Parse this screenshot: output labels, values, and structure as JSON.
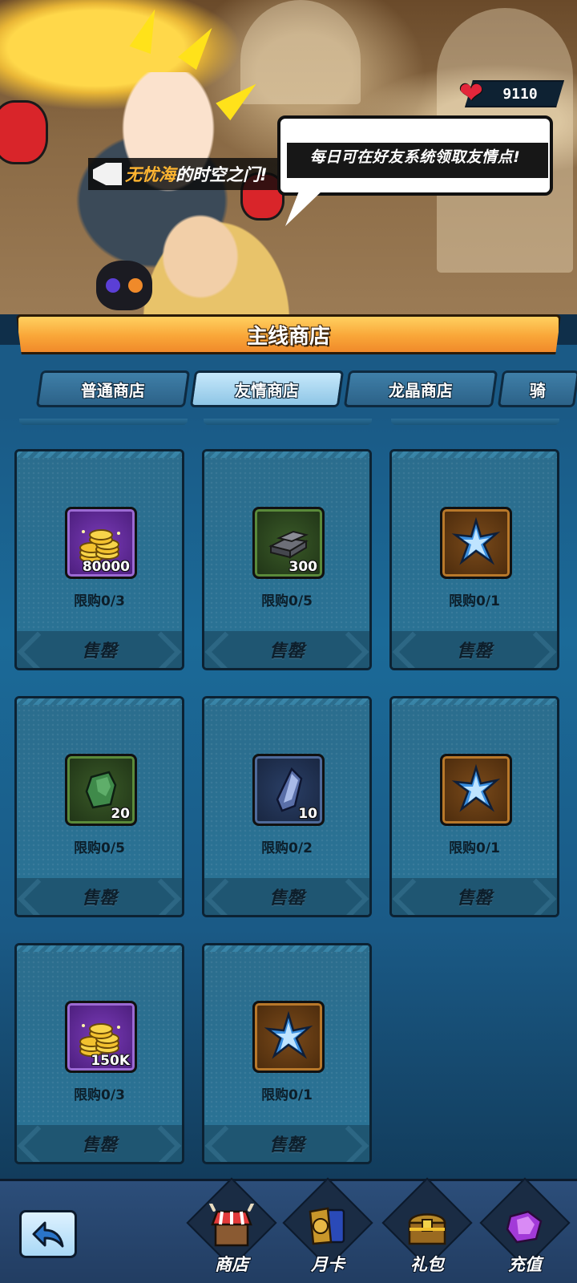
{
  "hero": {
    "announcement_highlight": "无忧海",
    "announcement_rest": "的时空之门!",
    "speech_bubble": "每日可在好友系统领取友情点!",
    "currency_value": "9110"
  },
  "shop": {
    "title": "主线商店",
    "tabs": [
      {
        "label": "普通商店",
        "active": false
      },
      {
        "label": "友情商店",
        "active": true
      },
      {
        "label": "龙晶商店",
        "active": false
      },
      {
        "label": "骑",
        "active": false
      }
    ]
  },
  "items": [
    {
      "icon": "gold-coins-icon",
      "frame": "purple",
      "qty": "80000",
      "limit": "限购0/3",
      "status": "售罄"
    },
    {
      "icon": "iron-ingot-icon",
      "frame": "green",
      "qty": "300",
      "limit": "限购0/5",
      "status": "售罄"
    },
    {
      "icon": "blue-crystal-star-icon",
      "frame": "orange",
      "qty": "",
      "limit": "限购0/1",
      "status": "售罄"
    },
    {
      "icon": "green-ore-icon",
      "frame": "green",
      "qty": "20",
      "limit": "限购0/5",
      "status": "售罄"
    },
    {
      "icon": "blue-ore-icon",
      "frame": "blue",
      "qty": "10",
      "limit": "限购0/2",
      "status": "售罄"
    },
    {
      "icon": "blue-crystal-star-icon",
      "frame": "orange",
      "qty": "",
      "limit": "限购0/1",
      "status": "售罄"
    },
    {
      "icon": "gold-coins-icon",
      "frame": "purple",
      "qty": "150K",
      "limit": "限购0/3",
      "status": "售罄"
    },
    {
      "icon": "blue-crystal-star-icon",
      "frame": "orange",
      "qty": "",
      "limit": "限购0/1",
      "status": "售罄"
    }
  ],
  "bottom_nav": {
    "back_icon": "back-arrow-icon",
    "items": [
      {
        "label": "商店",
        "icon": "shop-stall-icon"
      },
      {
        "label": "月卡",
        "icon": "month-card-icon"
      },
      {
        "label": "礼包",
        "icon": "treasure-chest-icon"
      },
      {
        "label": "充值",
        "icon": "purple-gem-icon"
      }
    ]
  },
  "colors": {
    "accent_orange": "#f9a638",
    "panel_blue": "#1a5a86",
    "highlight_text": "#ffb531",
    "heart_red": "#e3263b"
  }
}
